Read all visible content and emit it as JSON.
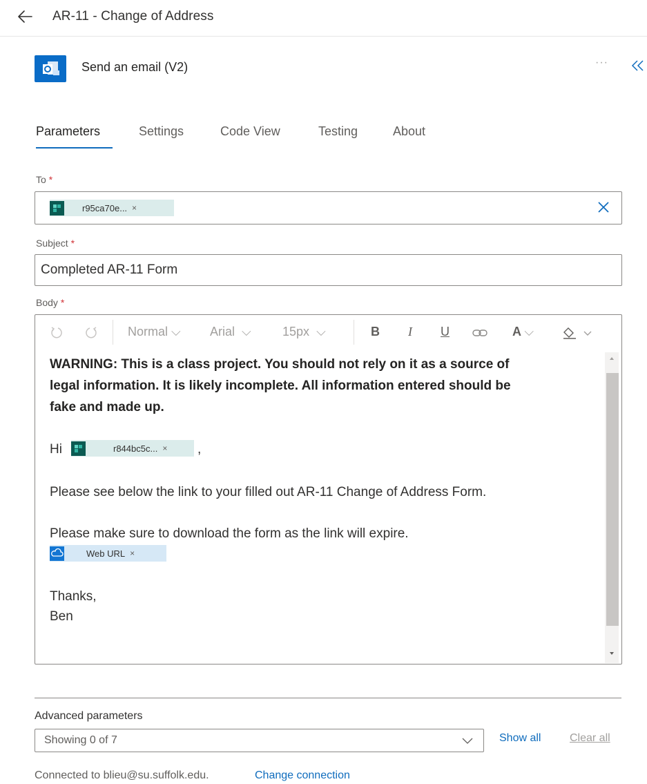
{
  "header": {
    "title": "AR-11 - Change of Address"
  },
  "action": {
    "title": "Send an email (V2)",
    "more": "···"
  },
  "tabs": [
    {
      "label": "Parameters",
      "active": true
    },
    {
      "label": "Settings"
    },
    {
      "label": "Code View"
    },
    {
      "label": "Testing"
    },
    {
      "label": "About"
    }
  ],
  "fields": {
    "to": {
      "label": "To",
      "required": "*",
      "token": "r95ca70e...",
      "token_close": "×"
    },
    "subject": {
      "label": "Subject",
      "required": "*",
      "value": "Completed AR-11 Form"
    },
    "body": {
      "label": "Body",
      "required": "*"
    }
  },
  "toolbar": {
    "style": "Normal",
    "font": "Arial",
    "size": "15px",
    "bold": "B",
    "italic": "I",
    "underline": "U",
    "font_color": "A"
  },
  "body_content": {
    "warning_line1": "WARNING: This is a class project. You should not rely on it as a source of",
    "warning_line2": "legal information. It is likely incomplete. All information entered should be",
    "warning_line3": "fake and made up.",
    "greeting": "Hi",
    "greeting_token": "r844bc5c...",
    "greeting_token_close": "×",
    "greeting_comma": ",",
    "line_link": "Please see below the link to your filled out AR-11 Change of Address Form.",
    "line_download": "Please make sure to download the form as the link will expire.",
    "url_token": "Web URL",
    "url_token_close": "×",
    "thanks": "Thanks,",
    "signature": "Ben"
  },
  "advanced": {
    "label": "Advanced parameters",
    "select_value": "Showing 0 of 7",
    "show_all": "Show all",
    "clear_all": "Clear all"
  },
  "footer": {
    "connected": "Connected to blieu@su.suffolk.edu.",
    "change": "Change connection"
  },
  "colors": {
    "accent": "#0f6cbd",
    "app_icon": "#0a6cc7",
    "token_bg": "#dbeceb",
    "token_icon": "#0b5a52",
    "required": "#d13438"
  }
}
